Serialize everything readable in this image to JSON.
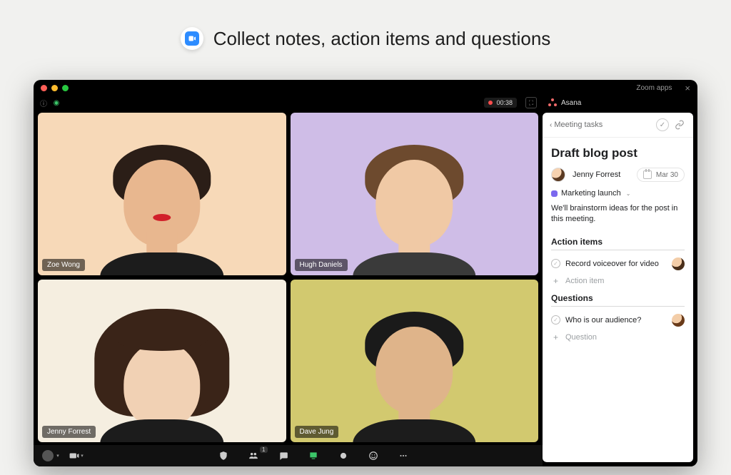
{
  "promo": {
    "title": "Collect notes, action items and questions"
  },
  "window": {
    "titlebar_label": "Zoom apps"
  },
  "zoom": {
    "timer": "00:38",
    "participants_count": "1",
    "tiles": [
      {
        "name": "Zoe Wong"
      },
      {
        "name": "Hugh Daniels"
      },
      {
        "name": "Jenny Forrest"
      },
      {
        "name": "Dave Jung"
      }
    ]
  },
  "asana": {
    "app_name": "Asana",
    "back_label": "Meeting tasks",
    "task_title": "Draft blog post",
    "assignee": "Jenny Forrest",
    "due": "Mar 30",
    "project": "Marketing launch",
    "description": "We'll brainstorm ideas for the post in this meeting.",
    "sections": {
      "action_items": {
        "title": "Action items",
        "items": [
          {
            "text": "Record voiceover for video"
          }
        ],
        "add_label": "Action item"
      },
      "questions": {
        "title": "Questions",
        "items": [
          {
            "text": "Who is our audience?"
          }
        ],
        "add_label": "Question"
      }
    }
  }
}
